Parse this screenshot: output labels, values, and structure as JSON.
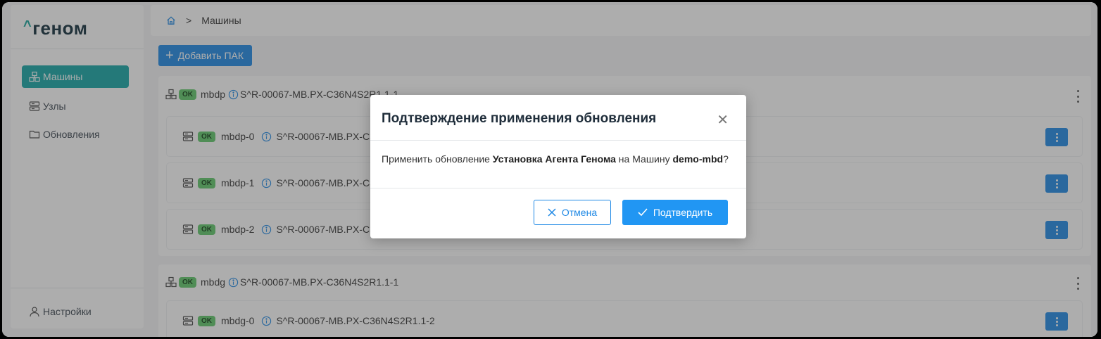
{
  "app": {
    "logo_text": "геном",
    "logo_caret": "^"
  },
  "sidebar": {
    "items": [
      {
        "label": "Машины",
        "icon": "machines-icon",
        "active": true
      },
      {
        "label": "Узлы",
        "icon": "nodes-icon",
        "active": false
      },
      {
        "label": "Обновления",
        "icon": "folder-icon",
        "active": false
      }
    ],
    "settings_label": "Настройки"
  },
  "breadcrumb": {
    "current": "Машины",
    "separator": ">"
  },
  "toolbar": {
    "add_label": "Добавить ПАК"
  },
  "machines": [
    {
      "name": "mbdp",
      "serial": "S^R-00067-MB.PX-C36N4S2R1.1-1",
      "status": "OK",
      "nodes": [
        {
          "name": "mbdp-0",
          "serial": "S^R-00067-MB.PX-C36N4S2R1.1-2",
          "status": "OK"
        },
        {
          "name": "mbdp-1",
          "serial": "S^R-00067-MB.PX-C36N4S2R1.1-3",
          "status": "OK"
        },
        {
          "name": "mbdp-2",
          "serial": "S^R-00067-MB.PX-C36N4S2R1.1-4",
          "status": "OK"
        }
      ]
    },
    {
      "name": "mbdg",
      "serial": "S^R-00067-MB.PX-C36N4S2R1.1-1",
      "status": "OK",
      "nodes": [
        {
          "name": "mbdg-0",
          "serial": "S^R-00067-MB.PX-C36N4S2R1.1-2",
          "status": "OK"
        }
      ]
    }
  ],
  "dialog": {
    "title": "Подтверждение применения обновления",
    "body_prefix": "Применить обновление ",
    "update_name": "Установка Агента Генома",
    "body_middle": " на Машину ",
    "machine_name": "demo-mbd",
    "body_suffix": "?",
    "cancel_label": "Отмена",
    "confirm_label": "Подтвердить"
  },
  "colors": {
    "accent": "#1e88e5",
    "active_nav": "#14a5a5",
    "ok_badge": "#5fc96a"
  }
}
